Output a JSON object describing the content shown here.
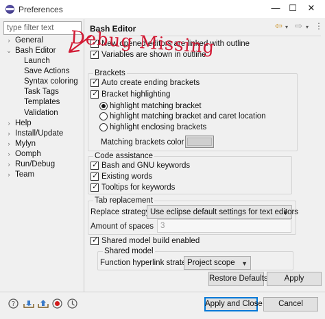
{
  "window": {
    "title": "Preferences",
    "controls": {
      "minimize": "—",
      "maximize": "☐",
      "close": "✕"
    }
  },
  "filter": {
    "placeholder": "type filter text"
  },
  "tree": [
    {
      "id": "general",
      "label": "General",
      "expander": "›"
    },
    {
      "id": "bash-editor",
      "label": "Bash Editor",
      "expander": "⌄"
    },
    {
      "id": "launch",
      "label": "Launch"
    },
    {
      "id": "save-actions",
      "label": "Save Actions"
    },
    {
      "id": "syntax-coloring",
      "label": "Syntax coloring"
    },
    {
      "id": "task-tags",
      "label": "Task Tags"
    },
    {
      "id": "templates",
      "label": "Templates"
    },
    {
      "id": "validation",
      "label": "Validation"
    },
    {
      "id": "help",
      "label": "Help",
      "expander": "›"
    },
    {
      "id": "install-update",
      "label": "Install/Update",
      "expander": "›"
    },
    {
      "id": "mylyn",
      "label": "Mylyn",
      "expander": "›"
    },
    {
      "id": "oomph",
      "label": "Oomph",
      "expander": "›"
    },
    {
      "id": "run-debug",
      "label": "Run/Debug",
      "expander": "›"
    },
    {
      "id": "team",
      "label": "Team",
      "expander": "›"
    }
  ],
  "page": {
    "title": "Bash Editor",
    "nav": {
      "back": "⇦",
      "forward": "⇨",
      "dropdown": "▾",
      "menu": "⋮"
    },
    "top_options": [
      {
        "label": "New opened editors are linked with outline",
        "checked": true
      },
      {
        "label": "Variables are shown in outline",
        "checked": true
      }
    ],
    "brackets": {
      "title": "Brackets",
      "auto_create": {
        "label": "Auto create ending brackets",
        "checked": true
      },
      "highlighting": {
        "label": "Bracket highlighting",
        "checked": true
      },
      "radios": [
        {
          "label": "highlight matching bracket",
          "selected": true
        },
        {
          "label": "highlight matching bracket and caret location",
          "selected": false
        },
        {
          "label": "highlight enclosing brackets",
          "selected": false
        }
      ],
      "color_label": "Matching brackets color",
      "color": "#cfcfcf"
    },
    "code_assistance": {
      "title": "Code assistance",
      "options": [
        {
          "label": "Bash and GNU keywords",
          "checked": true
        },
        {
          "label": "Existing words",
          "checked": true
        },
        {
          "label": "Tooltips for keywords",
          "checked": true
        }
      ]
    },
    "tab_replacement": {
      "title": "Tab replacement",
      "strategy_label": "Replace strategy",
      "strategy_value": "Use eclipse default settings for text editors",
      "spaces_label": "Amount of spaces",
      "spaces_value": "3"
    },
    "shared_model": {
      "checkbox": {
        "label": "Shared model build enabled",
        "checked": true
      },
      "title": "Shared model",
      "hyperlink_label": "Function hyperlink strategy",
      "hyperlink_value": "Project scope"
    },
    "buttons": {
      "restore": "Restore Defaults",
      "apply": "Apply"
    }
  },
  "footer": {
    "icons": [
      "help-icon",
      "import-icon",
      "export-icon",
      "record-icon",
      "oomph-icon"
    ],
    "apply_close": "Apply and Close",
    "cancel": "Cancel"
  },
  "annotation": {
    "text": "Debug Missing",
    "color": "#d21b35"
  }
}
